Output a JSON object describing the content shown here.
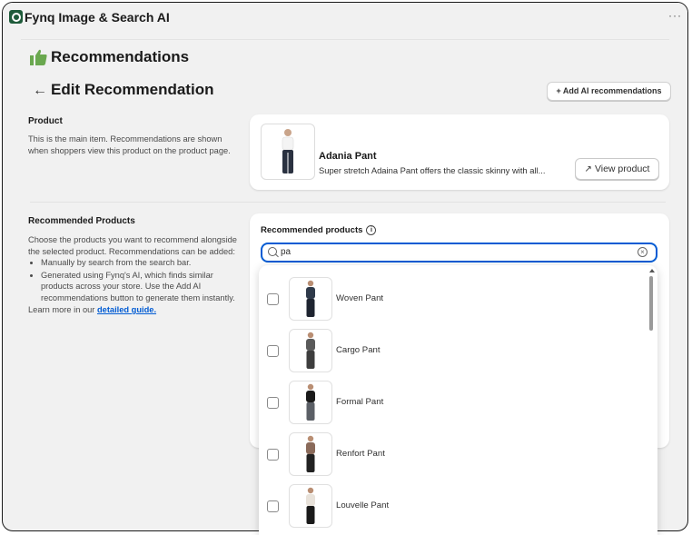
{
  "app": {
    "title": "Fynq Image & Search AI",
    "more_label": "···"
  },
  "header": {
    "section_title": "Recommendations",
    "back_label": "←",
    "page_title": "Edit Recommendation",
    "ai_button_label": "+ Add AI recommendations"
  },
  "product_section": {
    "title": "Product",
    "description": "This is the main item. Recommendations are shown when shoppers view this product on the product page."
  },
  "product_card": {
    "name": "Adania Pant",
    "description": "Super stretch Adaina Pant offers the classic skinny with all...",
    "view_button_label": "View product",
    "external_icon": "↗"
  },
  "recommended_section": {
    "title": "Recommended Products",
    "intro": "Choose the products you want to recommend alongside the selected product. Recommendations can be added:",
    "bullets": [
      "Manually by search from the search bar.",
      "Generated using Fynq's AI, which finds similar products across your store. Use the Add AI recommendations button to generate them instantly."
    ],
    "learn_prefix": "Learn more in our ",
    "learn_link": "detailed guide."
  },
  "recommended_card": {
    "label": "Recommended products",
    "info_icon": "i",
    "search": {
      "value": "pa",
      "placeholder": ""
    },
    "clear_icon": "×"
  },
  "dropdown": {
    "options": [
      {
        "label": "Woven Pant",
        "top": "#2f3a4a",
        "bottom": "#1e2430"
      },
      {
        "label": "Cargo Pant",
        "top": "#5a5a5a",
        "bottom": "#3d3d3d"
      },
      {
        "label": "Formal Pant",
        "top": "#1a1a1a",
        "bottom": "#5b5f66"
      },
      {
        "label": "Renfort Pant",
        "top": "#8a6a5a",
        "bottom": "#222222"
      },
      {
        "label": "Louvelle Pant",
        "top": "#e8e2da",
        "bottom": "#1a1a1a"
      }
    ]
  },
  "colors": {
    "accent": "#005bd3",
    "brand": "#1e5b3a",
    "thumb_icon": "#6aa84f"
  }
}
